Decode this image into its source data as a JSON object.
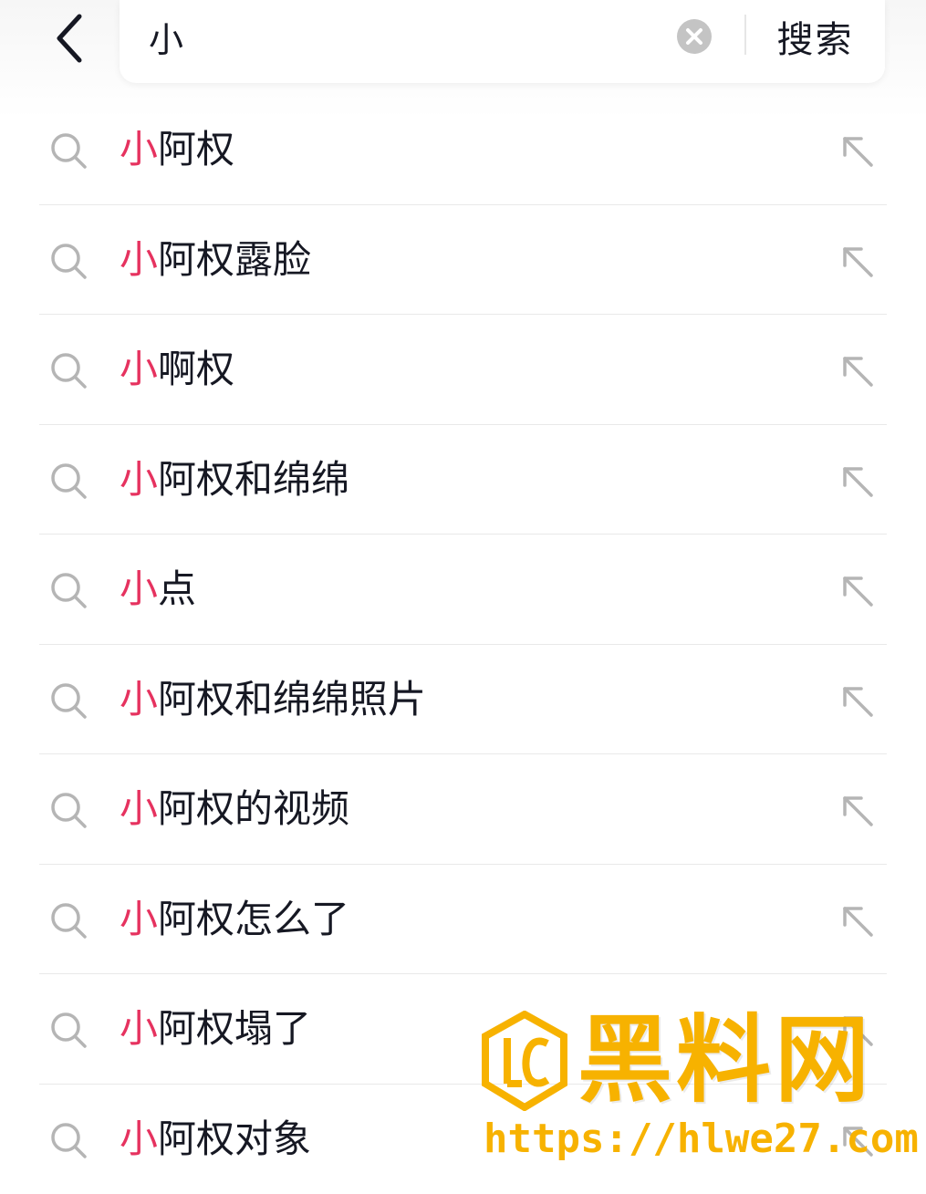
{
  "search": {
    "query": "小",
    "button_label": "搜索"
  },
  "colors": {
    "highlight": "#e6325f",
    "text": "#161823",
    "icon": "#b5b5b5",
    "watermark": "#f7b200"
  },
  "suggestions": [
    {
      "match": "小",
      "rest": "阿权"
    },
    {
      "match": "小",
      "rest": "阿权露脸"
    },
    {
      "match": "小",
      "rest": "啊权"
    },
    {
      "match": "小",
      "rest": "阿权和绵绵"
    },
    {
      "match": "小",
      "rest": "点"
    },
    {
      "match": "小",
      "rest": "阿权和绵绵照片"
    },
    {
      "match": "小",
      "rest": "阿权的视频"
    },
    {
      "match": "小",
      "rest": "阿权怎么了"
    },
    {
      "match": "小",
      "rest": "阿权塌了"
    },
    {
      "match": "小",
      "rest": "阿权对象"
    }
  ],
  "watermark": {
    "title": "黑料网",
    "url": "https://hlwe27.com"
  }
}
